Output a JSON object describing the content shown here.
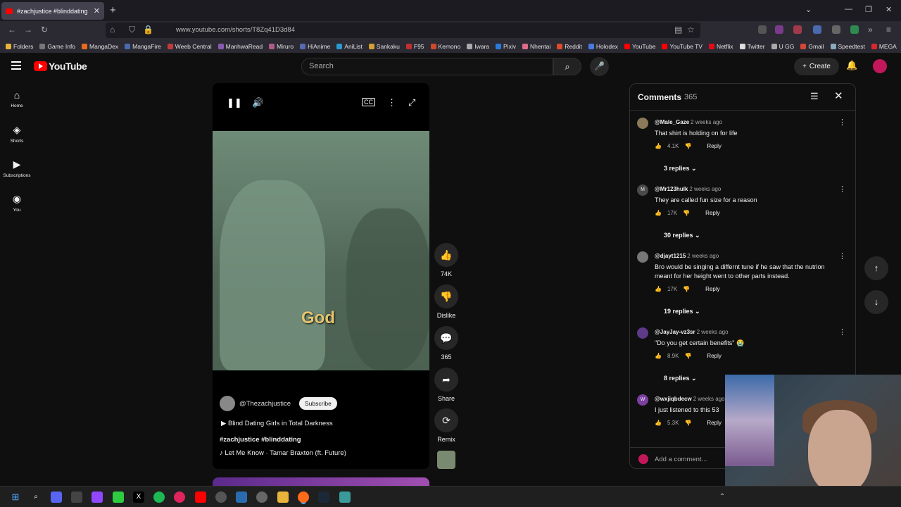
{
  "browser": {
    "tab_title": "#zachjustice #blinddating",
    "url": "www.youtube.com/shorts/T8Zq41D3d84",
    "bookmarks": [
      "Folders",
      "Game Info",
      "MangaDex",
      "MangaFire",
      "Weeb Central",
      "ManhwaRead",
      "Miruro",
      "HiAnime",
      "AniList",
      "Sankaku",
      "F95",
      "Kemono",
      "Iwara",
      "Pixiv",
      "Nhentai",
      "Reddit",
      "Holodex",
      "YouTube",
      "YouTube TV",
      "Netflix",
      "Twitter",
      "U GG",
      "Gmail",
      "Speedtest",
      "MEGA"
    ]
  },
  "youtube": {
    "logo_text": "YouTube",
    "search_placeholder": "Search",
    "create_label": "Create",
    "rail": [
      {
        "label": "Home",
        "icon": "home-icon"
      },
      {
        "label": "Shorts",
        "icon": "shorts-icon"
      },
      {
        "label": "Subscriptions",
        "icon": "subscriptions-icon"
      },
      {
        "label": "You",
        "icon": "you-icon"
      }
    ]
  },
  "video": {
    "caption": "God",
    "channel": "@Thezachjustice",
    "subscribe_label": "Subscribe",
    "title": "Blind Dating Girls in Total Darkness",
    "tags": "#zachjustice #blinddating",
    "music": "Let Me Know · Tamar Braxton (ft. Future)"
  },
  "actions": {
    "likes": "74K",
    "dislike_label": "Dislike",
    "comments": "365",
    "share_label": "Share",
    "remix_label": "Remix"
  },
  "comments_panel": {
    "title": "Comments",
    "count": "365",
    "add_placeholder": "Add a comment...",
    "items": [
      {
        "author": "@Male_Gaze",
        "time": "2 weeks ago",
        "text": "That shirt is holding on for life",
        "likes": "4.1K",
        "replies": "3 replies",
        "avatar_letter": "",
        "avatar_color": "#8a7a5a"
      },
      {
        "author": "@Mr123hulk",
        "time": "2 weeks ago",
        "text": "They are called fun size for a reason",
        "likes": "17K",
        "replies": "30 replies",
        "avatar_letter": "M",
        "avatar_color": "#4a4a4a"
      },
      {
        "author": "@djayt1215",
        "time": "2 weeks ago",
        "text": "Bro would be singing a differnt tune if he saw that the nutrion meant for her height went to other parts instead.",
        "likes": "17K",
        "replies": "19 replies",
        "avatar_letter": "",
        "avatar_color": "#777777"
      },
      {
        "author": "@JayJay-vz3sr",
        "time": "2 weeks ago",
        "text": "\"Do you get certain benefits\" 😭",
        "likes": "8.9K",
        "replies": "8 replies",
        "avatar_letter": "",
        "avatar_color": "#5e3a8a"
      },
      {
        "author": "@wxjiqbdecw",
        "time": "2 weeks ago",
        "text": "I just listened to this 53",
        "likes": "5.3K",
        "replies": "",
        "avatar_letter": "W",
        "avatar_color": "#7b3fa0"
      }
    ],
    "reply_label": "Reply"
  }
}
